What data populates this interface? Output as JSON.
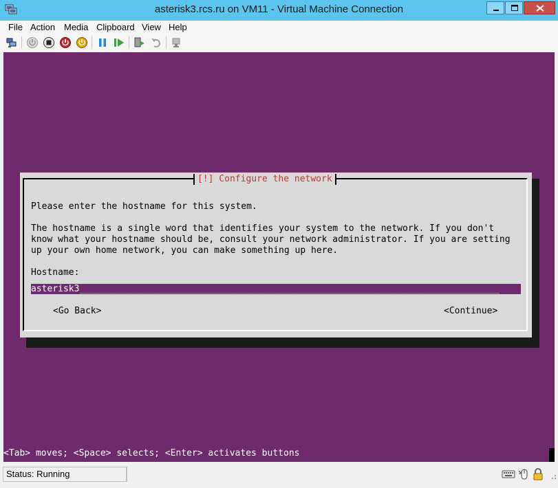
{
  "window": {
    "title": "asterisk3.rcs.ru on VM11 - Virtual Machine Connection"
  },
  "menu": {
    "items": [
      "File",
      "Action",
      "Media",
      "Clipboard",
      "View",
      "Help"
    ]
  },
  "toolbar": {
    "icons": [
      "ctrl-alt-del-icon",
      "start-icon",
      "turn-off-icon",
      "shut-down-icon",
      "save-icon",
      "pause-icon",
      "reset-icon",
      "checkpoint-icon",
      "revert-icon",
      "enhanced-session-icon"
    ]
  },
  "installer": {
    "dialog_title": "[!] Configure the network",
    "prompt": "Please enter the hostname for this system.",
    "description": [
      "The hostname is a single word that identifies your system to the network. If you don't",
      "know what your hostname should be, consult your network administrator. If you are setting",
      "up your own home network, you can make something up here."
    ],
    "hostname_label": "Hostname:",
    "hostname_value": "asterisk3",
    "go_back_label": "<Go Back>",
    "continue_label": "<Continue>",
    "hint": "<Tab> moves; <Space> selects; <Enter> activates buttons"
  },
  "status": {
    "text": "Status: Running"
  },
  "colors": {
    "titlebar": "#5bc4ef",
    "vm_background": "#6d2a6c",
    "dialog_background": "#d9d9d9",
    "dialog_title": "#c0392b"
  }
}
